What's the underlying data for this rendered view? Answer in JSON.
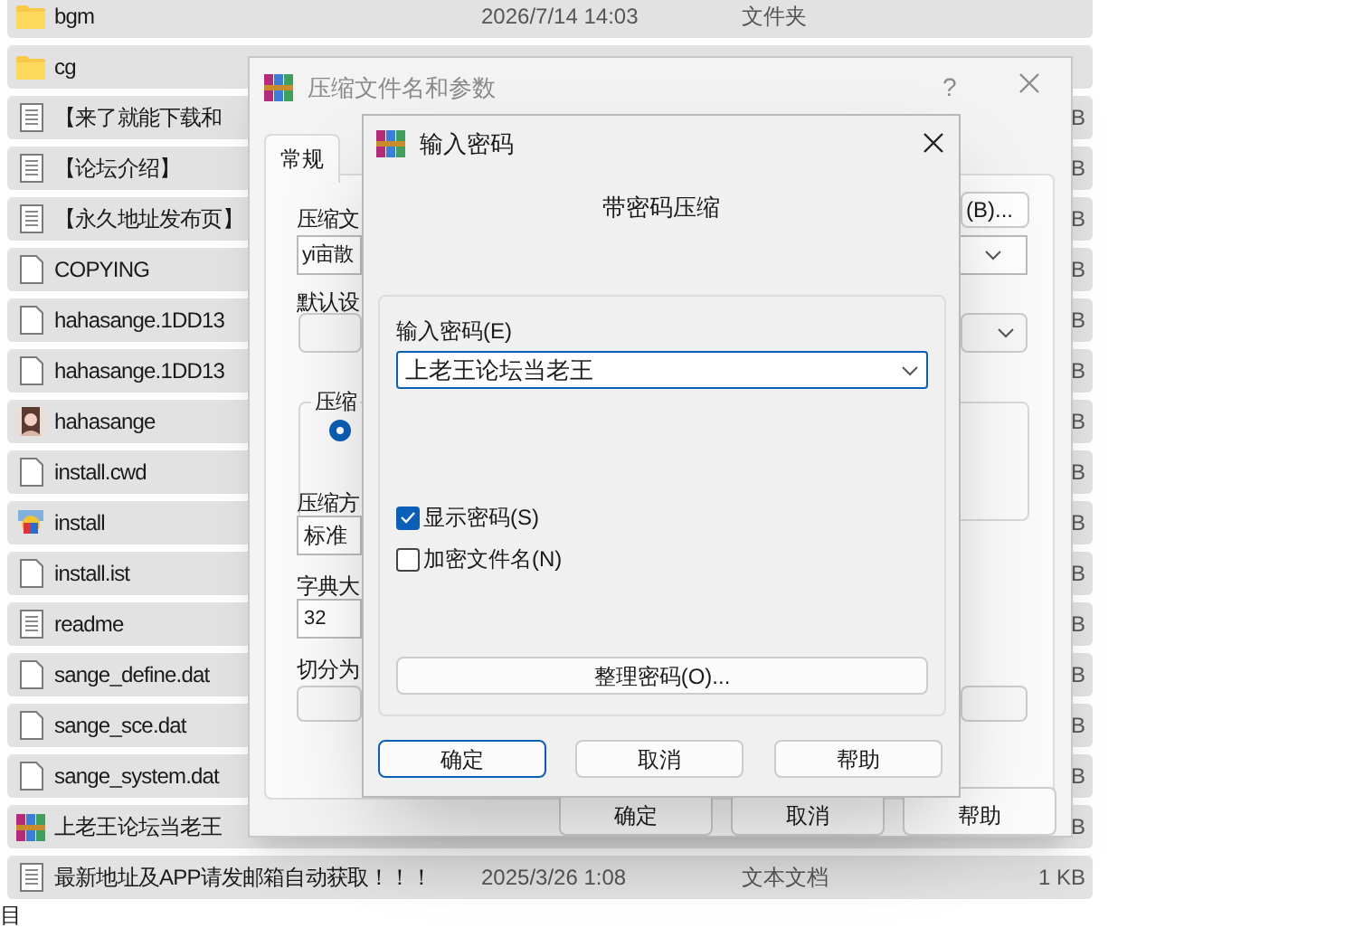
{
  "files": [
    {
      "name": "bgm",
      "kind": "folder",
      "date": "2026/7/14 14:03",
      "type": "文件夹"
    },
    {
      "name": "cg",
      "kind": "folder"
    },
    {
      "name": "【来了就能下载和",
      "kind": "document",
      "size": "B"
    },
    {
      "name": "【论坛介绍】",
      "kind": "document",
      "size": "B"
    },
    {
      "name": "【永久地址发布页】",
      "kind": "document",
      "size": "B"
    },
    {
      "name": "COPYING",
      "kind": "file",
      "size": "B"
    },
    {
      "name": "hahasange.1DD13",
      "kind": "file",
      "size": "B"
    },
    {
      "name": "hahasange.1DD13",
      "kind": "file",
      "size": "B"
    },
    {
      "name": "hahasange",
      "kind": "picture",
      "size": "B"
    },
    {
      "name": "install.cwd",
      "kind": "file",
      "size": "B"
    },
    {
      "name": "install",
      "kind": "app",
      "size": "B"
    },
    {
      "name": "install.ist",
      "kind": "file",
      "size": "B"
    },
    {
      "name": "readme",
      "kind": "document",
      "size": "B"
    },
    {
      "name": "sange_define.dat",
      "kind": "file",
      "size": "B"
    },
    {
      "name": "sange_sce.dat",
      "kind": "file",
      "size": "B"
    },
    {
      "name": "sange_system.dat",
      "kind": "file",
      "size": "B"
    },
    {
      "name": "上老王论坛当老王",
      "kind": "archive",
      "size": "B"
    },
    {
      "name": "最新地址及APP请发邮箱自动获取！！！",
      "kind": "document",
      "date": "2025/3/26 1:08",
      "type": "文本文档",
      "size": "1 KB"
    }
  ],
  "status_bar": {
    "text": "目"
  },
  "archive_dialog": {
    "title": "压缩文件名和参数",
    "help": "?",
    "tabs": [
      {
        "label": "常规",
        "selected": true
      }
    ],
    "archive_name_label": "压缩文",
    "archive_name_value": "yi亩散",
    "browse_button": "(B)...",
    "profile_label": "默认设",
    "format_group_label": "压缩",
    "format_radio": {
      "selected": true
    },
    "method_label": "压缩方",
    "method_value": "标准",
    "dictionary_label": "字典大",
    "dictionary_value": "32",
    "split_label": "切分为",
    "buttons": [
      "确定",
      "取消",
      "帮助"
    ]
  },
  "password_dialog": {
    "title": "输入密码",
    "heading": "带密码压缩",
    "password_label": "输入密码(E)",
    "password_value": "上老王论坛当老王",
    "checkboxes": [
      {
        "label": "显示密码(S)",
        "checked": true
      },
      {
        "label": "加密文件名(N)",
        "checked": false
      }
    ],
    "organize_button": "整理密码(O)...",
    "buttons": [
      {
        "label": "确定",
        "selected": true
      },
      {
        "label": "取消",
        "selected": false
      },
      {
        "label": "帮助",
        "selected": false
      }
    ]
  }
}
